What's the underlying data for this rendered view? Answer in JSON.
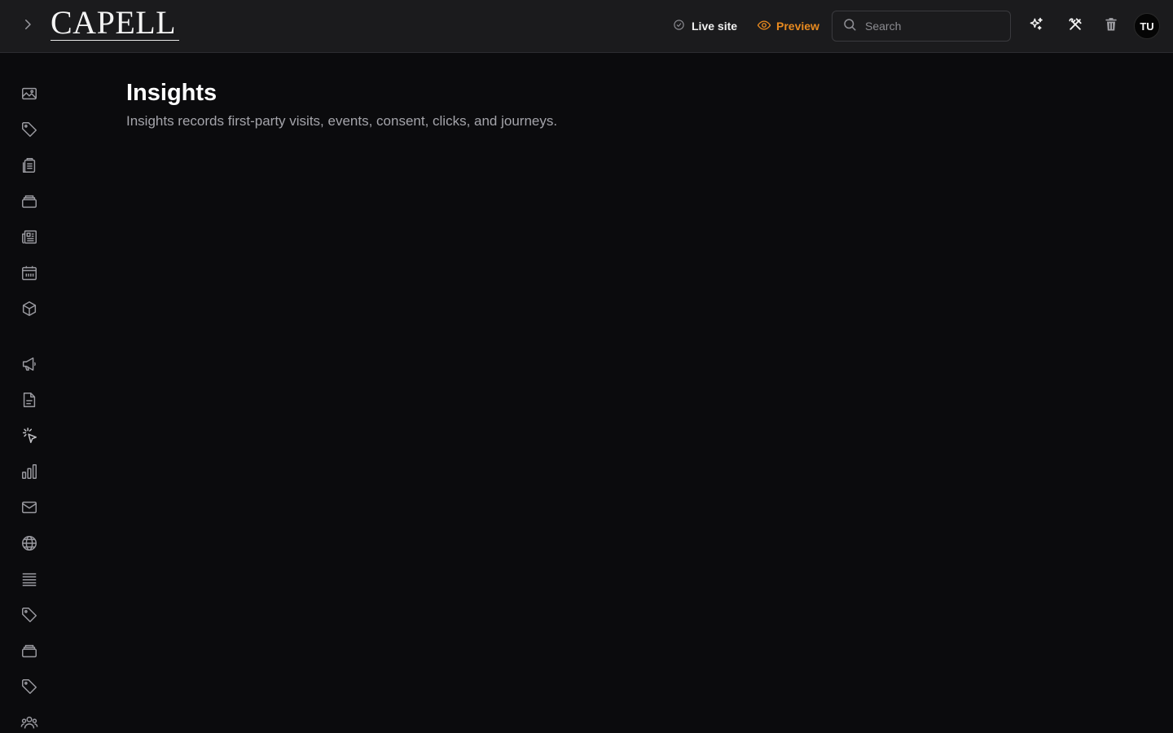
{
  "header": {
    "logo_text": "CAPELL",
    "live_site_label": "Live site",
    "preview_label": "Preview",
    "search_placeholder": "Search",
    "avatar_initials": "TU"
  },
  "page": {
    "title": "Insights",
    "description": "Insights records first-party visits, events, consent, clicks, and journeys."
  },
  "sidebar": {
    "icons": [
      "image-icon",
      "tag-icon",
      "clipboard-icon",
      "stack-icon",
      "newspaper-icon",
      "calendar-icon",
      "cube-icon",
      "megaphone-icon",
      "document-icon",
      "cursor-click-icon",
      "bar-chart-icon",
      "mail-icon",
      "globe-icon",
      "list-icon",
      "tag-icon",
      "stack-icon",
      "tag-icon",
      "users-icon"
    ]
  },
  "colors": {
    "background": "#0b0b0d",
    "topbar": "#1b1b1d",
    "accent": "#e88a1f",
    "icon": "#9a9aa0"
  }
}
